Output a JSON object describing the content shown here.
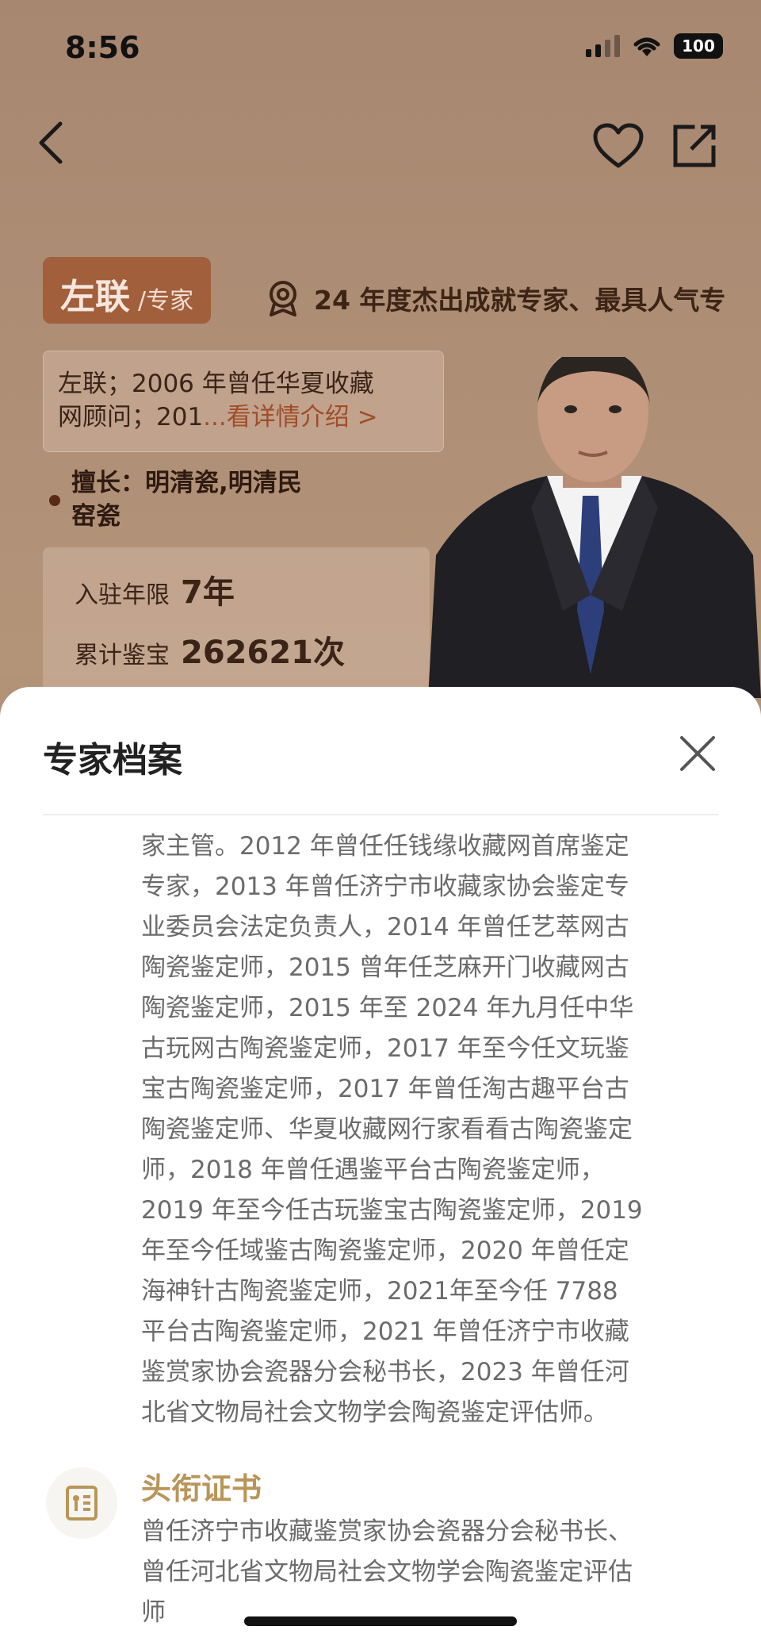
{
  "status_bar": {
    "time": "8:56",
    "battery": "100"
  },
  "expert": {
    "name": "左联",
    "role": "/专家",
    "award": "24 年度杰出成就专家、最具人气专",
    "intro_line1": "左联；2006 年曾任华夏收藏",
    "intro_line2_prefix": "网顾问；201",
    "intro_more": "...看详情介绍 >",
    "specialty_line1": "擅长：明清瓷,明清民",
    "specialty_line2": "窑瓷",
    "stats": [
      {
        "label": "入驻年限",
        "value": "7年"
      },
      {
        "label": "累计鉴宝",
        "value": "262621次"
      }
    ]
  },
  "sheet": {
    "title": "专家档案",
    "bio_lines": [
      "家主管。2012 年曾任任钱缘收藏网首席鉴定",
      "专家，2013 年曾任济宁市收藏家协会鉴定专",
      "业委员会法定负责人，2014 年曾任艺萃网古",
      "陶瓷鉴定师，2015 曾年任芝麻开门收藏网古",
      "陶瓷鉴定师，2015 年至 2024 年九月任中华",
      "古玩网古陶瓷鉴定师，2017 年至今任文玩鉴",
      "宝古陶瓷鉴定师，2017 年曾任淘古趣平台古",
      "陶瓷鉴定师、华夏收藏网行家看看古陶瓷鉴定",
      "师，2018 年曾任遇鉴平台古陶瓷鉴定师，",
      "2019 年至今任古玩鉴宝古陶瓷鉴定师，2019",
      "年至今任域鉴古陶瓷鉴定师，2020 年曾任定",
      "海神针古陶瓷鉴定师，2021年至今任 7788",
      "平台古陶瓷鉴定师，2021 年曾任济宁市收藏",
      "鉴赏家协会瓷器分会秘书长，2023 年曾任河",
      "北省文物局社会文物学会陶瓷鉴定评估师。"
    ],
    "title_section": {
      "heading": "头衔证书",
      "lines": [
        "曾任济宁市收藏鉴赏家协会瓷器分会秘书长、",
        "曾任河北省文物局社会文物学会陶瓷鉴定评估",
        "师"
      ]
    }
  },
  "icons": {
    "back": "chevron-left-icon",
    "favorite": "heart-icon",
    "share": "share-icon",
    "award": "medal-icon",
    "close": "close-icon",
    "certificate": "certificate-icon"
  },
  "colors": {
    "accent_badge": "#a25f3b",
    "link": "#a04d28",
    "section_heading": "#b99558"
  }
}
